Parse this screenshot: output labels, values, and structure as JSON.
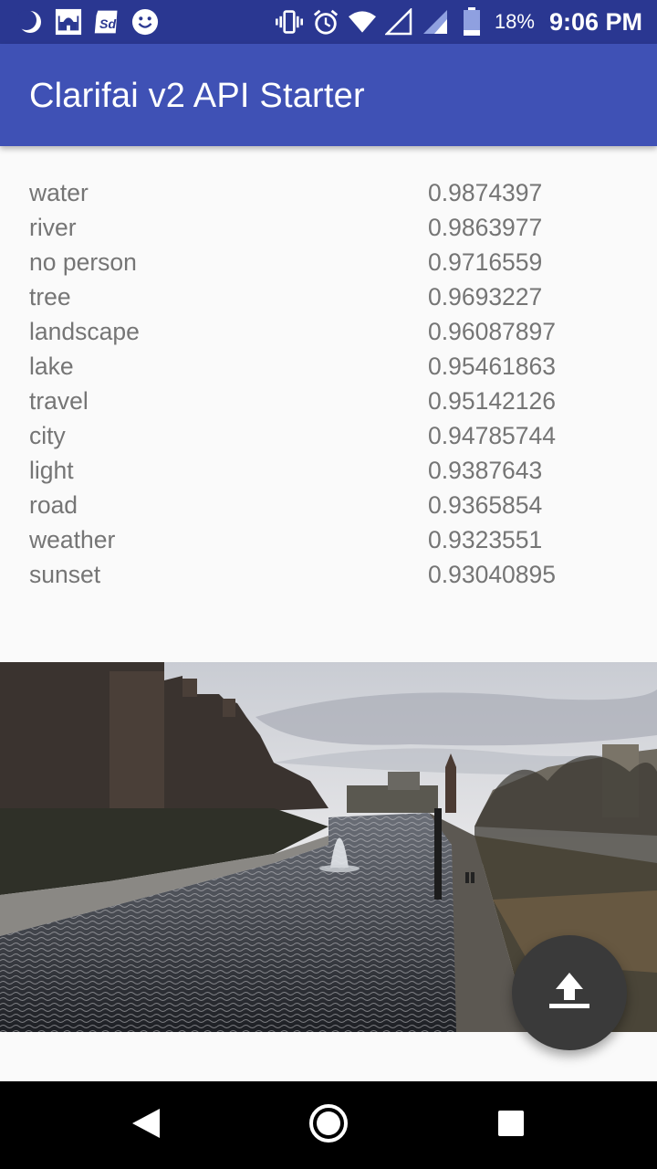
{
  "status_bar": {
    "battery_percent": "18%",
    "time": "9:06 PM",
    "left_icons": [
      "moon-icon",
      "mosque-icon",
      "sd-card-icon",
      "smiley-icon"
    ],
    "right_icons": [
      "vibrate-icon",
      "alarm-icon",
      "wifi-icon",
      "signal-empty-icon",
      "signal-icon",
      "battery-icon"
    ]
  },
  "app_bar": {
    "title": "Clarifai v2 API Starter"
  },
  "results": [
    {
      "tag": "water",
      "score": "0.9874397"
    },
    {
      "tag": "river",
      "score": "0.9863977"
    },
    {
      "tag": "no person",
      "score": "0.9716559"
    },
    {
      "tag": "tree",
      "score": "0.9693227"
    },
    {
      "tag": "landscape",
      "score": "0.96087897"
    },
    {
      "tag": "lake",
      "score": "0.95461863"
    },
    {
      "tag": "travel",
      "score": "0.95142126"
    },
    {
      "tag": "city",
      "score": "0.94785744"
    },
    {
      "tag": "light",
      "score": "0.9387643"
    },
    {
      "tag": "road",
      "score": "0.9365854"
    },
    {
      "tag": "weather",
      "score": "0.9323551"
    },
    {
      "tag": "sunset",
      "score": "0.93040895"
    }
  ],
  "fab": {
    "icon": "upload-icon"
  },
  "nav_bar": {
    "icons": [
      "back-icon",
      "home-icon",
      "recents-icon"
    ]
  },
  "colors": {
    "primary": "#3f51b5",
    "primary_dark": "#2a3791",
    "text_secondary": "#757575",
    "fab": "#3a3a3a"
  }
}
